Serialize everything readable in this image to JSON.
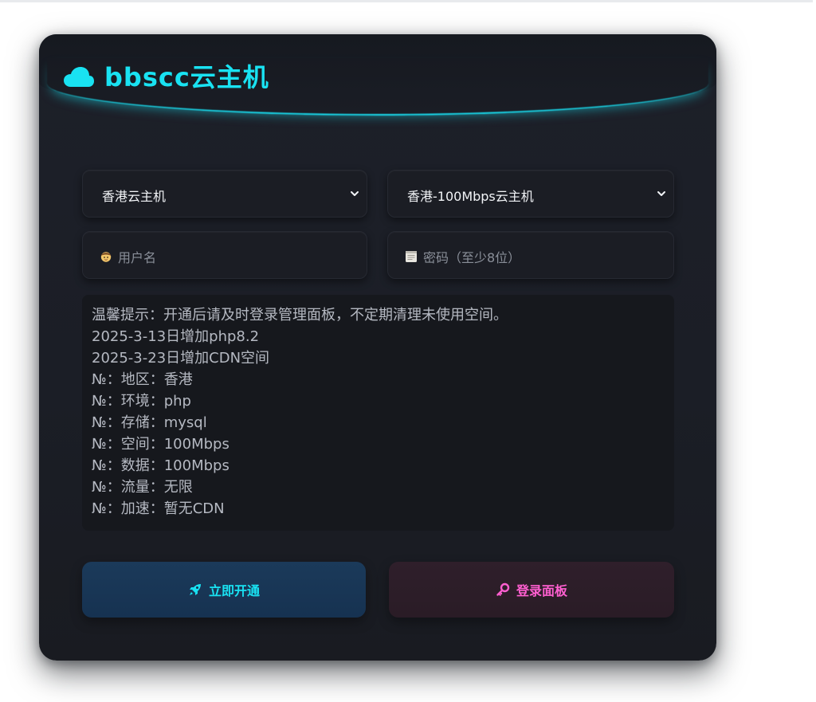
{
  "brand": {
    "title": "bbscc云主机",
    "icon": "cloud-icon"
  },
  "form": {
    "region_select": {
      "value": "香港云主机"
    },
    "plan_select": {
      "value": "香港-100Mbps云主机"
    },
    "username": {
      "placeholder": "用户名",
      "icon": "user-icon"
    },
    "password": {
      "placeholder": "密码（至少8位）",
      "icon": "note-icon"
    }
  },
  "notice": {
    "lines": [
      "温馨提示：开通后请及时登录管理面板，不定期清理未使用空间。",
      "2025-3-13日增加php8.2",
      "2025-3-23日增加CDN空间",
      "№：地区：香港",
      "№：环境：php",
      "№：存储：mysql",
      "№：空间：100Mbps",
      "№：数据：100Mbps",
      "№：流量：无限",
      "№：加速：暂无CDN"
    ]
  },
  "buttons": {
    "open": {
      "label": "立即开通",
      "icon": "rocket-icon"
    },
    "login": {
      "label": "登录面板",
      "icon": "key-icon"
    }
  },
  "colors": {
    "accent_cyan": "#19e2f2",
    "accent_pink": "#ff5fd0",
    "card_bg": "#1b1e26"
  }
}
